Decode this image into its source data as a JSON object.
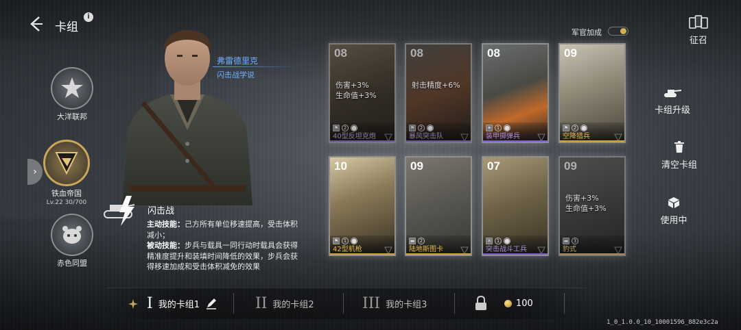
{
  "header": {
    "title": "卡组",
    "info_glyph": "i"
  },
  "factions": [
    {
      "name": "大洋联邦",
      "active": false
    },
    {
      "name": "铁血帝国",
      "active": true,
      "level": "Lv.22",
      "progress": "30/700"
    },
    {
      "name": "赤色同盟",
      "active": false
    }
  ],
  "commander": {
    "name": "弗雷德里克",
    "doctrine": "闪击战学说",
    "skill_title": "闪击战",
    "active_label": "主动技能：",
    "active_text": "己方所有单位移速提高，受击体积减小；",
    "passive_label": "被动技能：",
    "passive_text": "步兵与载具一同行动时载具会获得精准度提升和装填时间降低的效果，步兵会获得移速加成和受击体积减免的效果"
  },
  "officer_bonus": {
    "label": "军官加成",
    "enabled": true
  },
  "actions": {
    "recruit": "征召",
    "upgrade": "卡组升级",
    "clear": "清空卡组",
    "in_use": "使用中"
  },
  "cards": [
    {
      "cost": "08",
      "buff_lines": [
        "伤害+3%",
        "生命值+3%"
      ],
      "stats": [
        "⚑",
        "2",
        "⬤"
      ],
      "name": "40型反坦克炮",
      "name_color": "#a98ee0",
      "bar_color": "#7b5bd0",
      "highlight": false
    },
    {
      "cost": "08",
      "buff_lines": [
        "射击精度+6%"
      ],
      "stats": [
        "⚑",
        "2",
        "⬤"
      ],
      "name": "暴风突击队",
      "name_color": "#a98ee0",
      "bar_color": "#7b5bd0",
      "highlight": false
    },
    {
      "cost": "08",
      "buff_lines": [],
      "stats": [
        "✦",
        "1",
        "⬤"
      ],
      "name": "装甲掷弹兵",
      "name_color": "#a98ee0",
      "bar_color": "#7b5bd0",
      "highlight": true
    },
    {
      "cost": "09",
      "buff_lines": [],
      "stats": [
        "⚑",
        "2",
        "⬤"
      ],
      "name": "空降猎兵",
      "name_color": "#e6b94a",
      "bar_color": "#d4a53a",
      "highlight": true
    },
    {
      "cost": "10",
      "buff_lines": [],
      "stats": [
        "⚑",
        "1",
        "⬤"
      ],
      "name": "42型机枪",
      "name_color": "#e6b94a",
      "bar_color": "#d4a53a",
      "highlight": true
    },
    {
      "cost": "09",
      "buff_lines": [],
      "stats": [
        "▬",
        "2"
      ],
      "name": "陆地斯图卡",
      "name_color": "#e6b94a",
      "bar_color": "#d4a53a",
      "highlight": true
    },
    {
      "cost": "07",
      "buff_lines": [],
      "stats": [
        "✕",
        "1",
        "⬤"
      ],
      "name": "突击战斗工兵",
      "name_color": "#a98ee0",
      "bar_color": "#7b5bd0",
      "highlight": true
    },
    {
      "cost": "09",
      "buff_lines": [
        "伤害+3%",
        "生命值+3%"
      ],
      "stats": [
        "▬",
        "3"
      ],
      "name": "豹式",
      "name_color": "#e6b94a",
      "bar_color": "#d4a53a",
      "highlight": false
    }
  ],
  "decks": [
    {
      "roman": "I",
      "label": "我的卡组1",
      "active": true
    },
    {
      "roman": "II",
      "label": "我的卡组2",
      "active": false
    },
    {
      "roman": "III",
      "label": "我的卡组3",
      "active": false
    }
  ],
  "currency": {
    "value": "100"
  },
  "version": "1_0_1.0.0_10_10001596_882e3c2a"
}
